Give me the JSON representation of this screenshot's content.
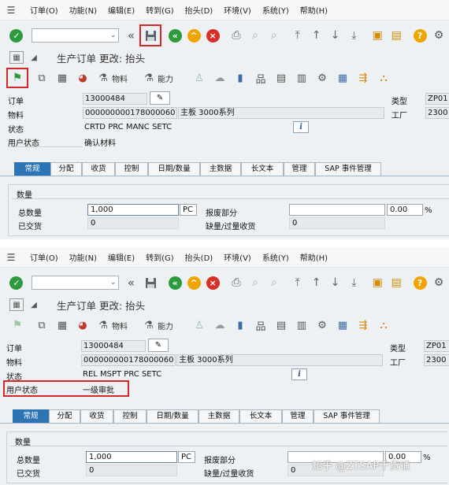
{
  "menu": [
    "订单(O)",
    "功能(N)",
    "编辑(E)",
    "转到(G)",
    "抬头(D)",
    "环境(V)",
    "系统(Y)",
    "帮助(H)"
  ],
  "toolbar": {
    "cmd_arrow": "⌄"
  },
  "title": "生产订单 更改: 抬头",
  "app_toolbar": {
    "material_label": "物料",
    "capacity_label": "能力"
  },
  "header": {
    "order_label": "订单",
    "order_value": "13000484",
    "material_label": "物料",
    "material_value": "000000000178000060",
    "material_desc": "主板 3000系列",
    "status_label": "状态",
    "user_status_label": "用户状态",
    "type_label": "类型",
    "type_value": "ZP01",
    "plant_label": "工厂",
    "plant_value": "2300"
  },
  "panels": [
    {
      "status_value": "CRTD PRC  MANC SETC",
      "user_status_value": "确认材料"
    },
    {
      "status_value": "REL  MSPT PRC  SETC",
      "user_status_value": "一级审批"
    }
  ],
  "tabs": [
    "常规",
    "分配",
    "收货",
    "控制",
    "日期/数量",
    "主数据",
    "长文本",
    "管理",
    "SAP 事件管理"
  ],
  "quantity": {
    "section_title": "数量",
    "total_label": "总数量",
    "total_value": "1,000",
    "unit": "PC",
    "delivered_label": "已交货",
    "delivered_value": "0",
    "scrap_label": "报废部分",
    "scrap_value": "",
    "scrap_pct": "0.00",
    "pct_sign": "%",
    "shortage_label": "缺量/过量收货",
    "shortage_value": "0"
  },
  "watermark": "知乎 @ZTSAP千货铺",
  "colors": {
    "accent": "#2d74b5",
    "highlight": "#d62828"
  }
}
